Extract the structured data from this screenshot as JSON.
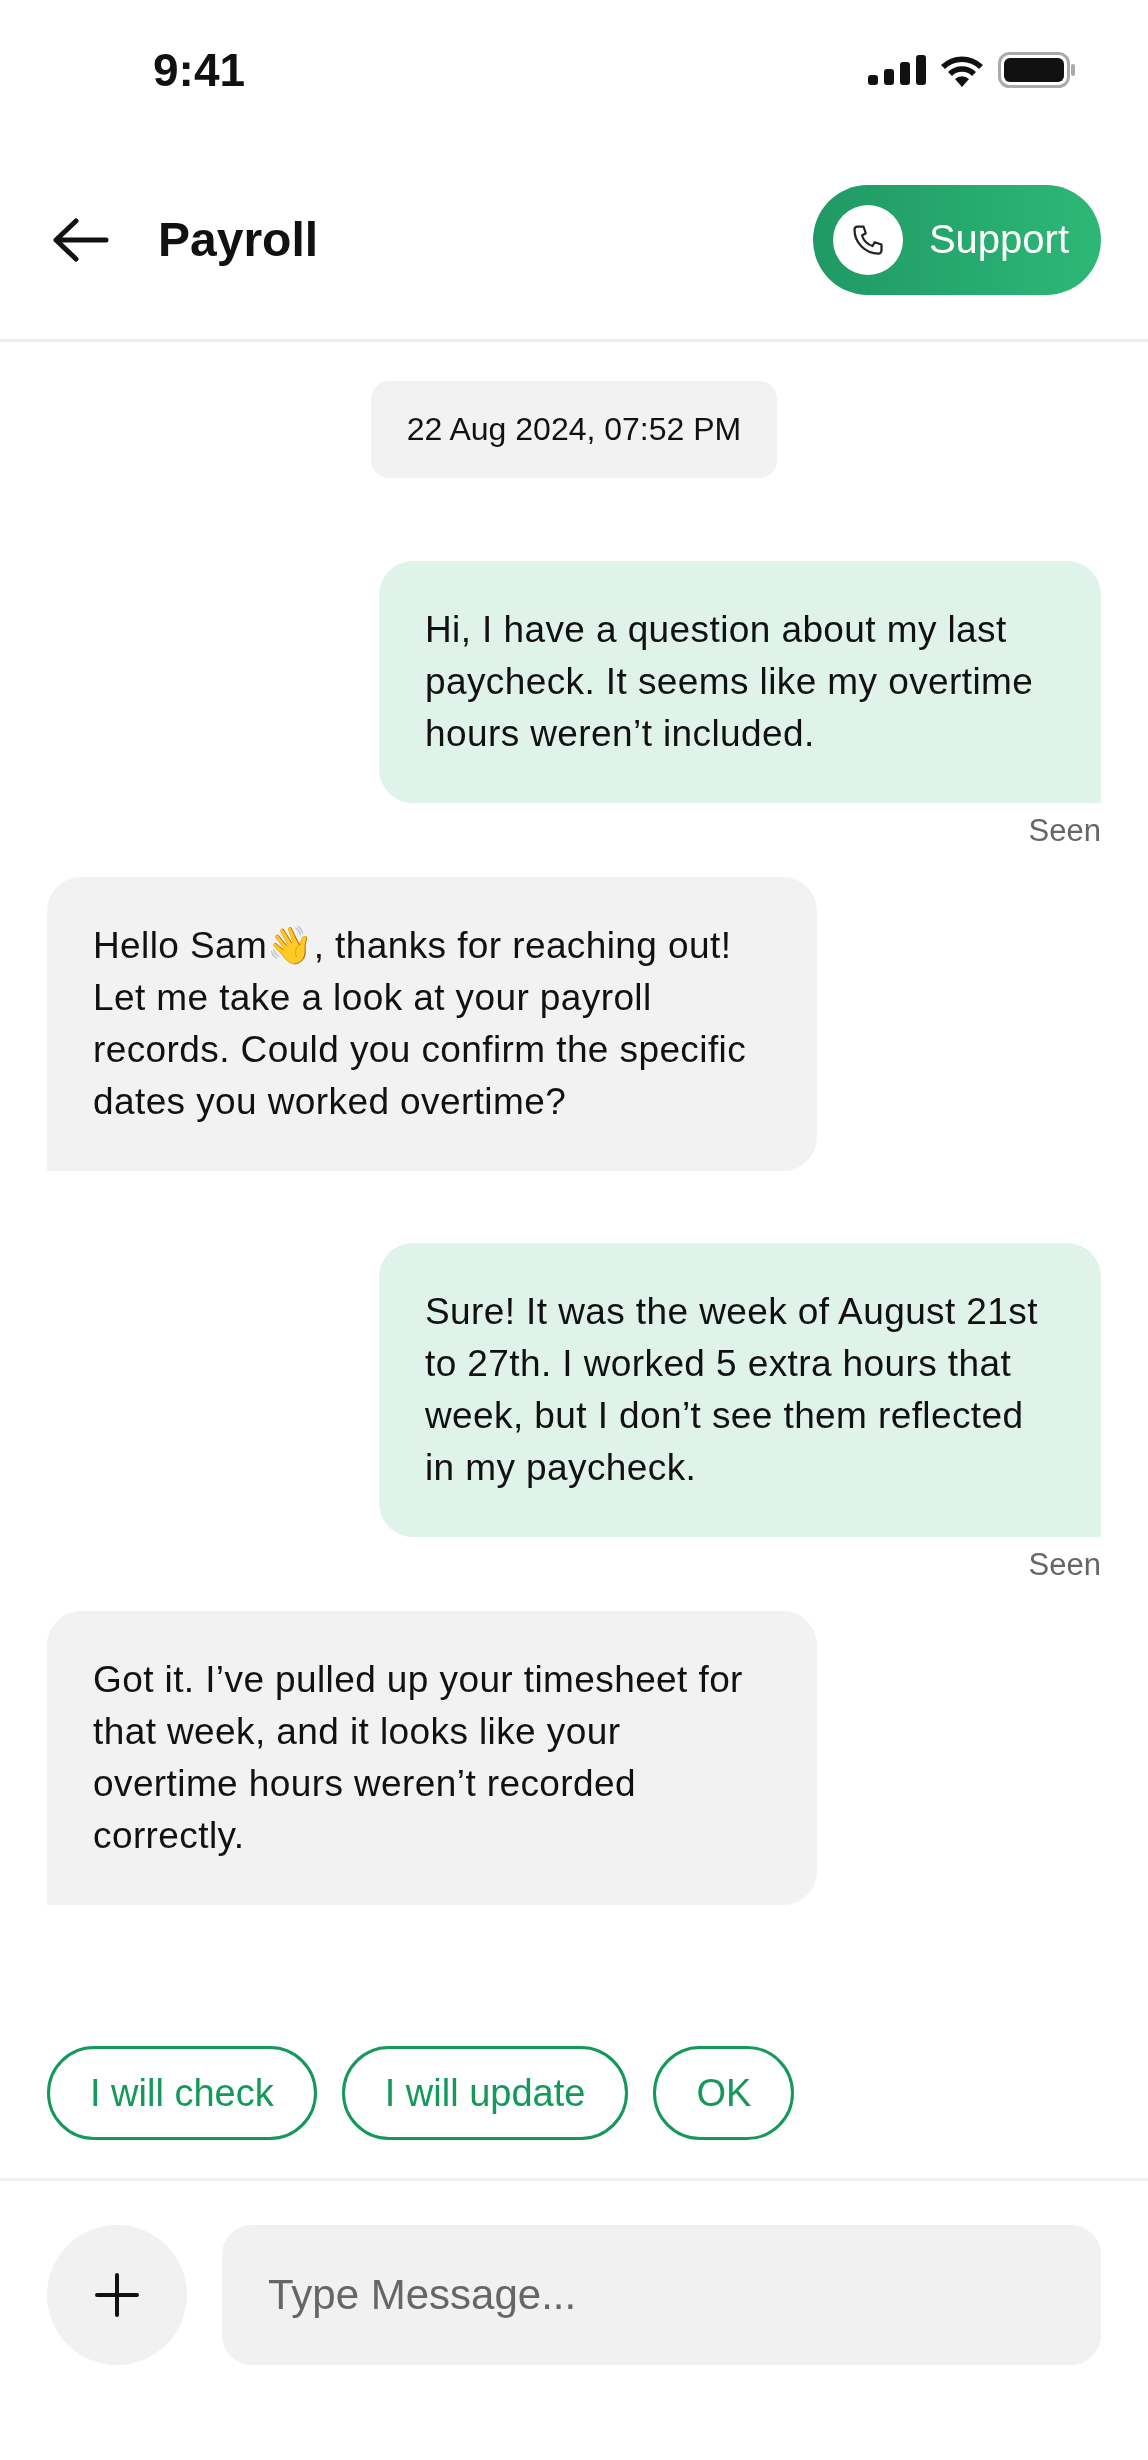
{
  "status_bar": {
    "time": "9:41"
  },
  "header": {
    "title": "Payroll",
    "support_button": "Support"
  },
  "date_chip": "22 Aug 2024, 07:52 PM",
  "messages": [
    {
      "kind": "sent",
      "text": "Hi, I have a question about my last paycheck. It seems like my overtime hours weren’t included.",
      "receipt": "Seen"
    },
    {
      "kind": "received",
      "text": "Hello Sam👋, thanks for reaching out! Let me take a look at your payroll records. Could you confirm the specific dates you worked overtime?"
    },
    {
      "kind": "sent",
      "text": "Sure! It was the week of August 21st to 27th. I worked 5 extra hours that week, but I don’t see them reflected in my paycheck.",
      "receipt": "Seen"
    },
    {
      "kind": "received",
      "text": "Got it. I’ve pulled up your timesheet for that week, and it looks like your overtime hours weren’t recorded correctly."
    }
  ],
  "quick_replies": [
    "I will check",
    "I will update",
    "OK"
  ],
  "composer": {
    "placeholder": "Type Message..."
  }
}
